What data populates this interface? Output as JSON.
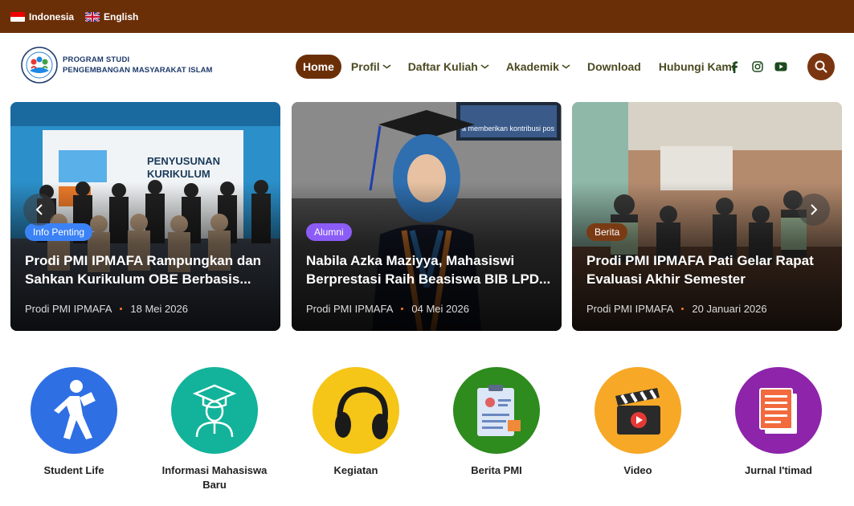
{
  "topbar": {
    "languages": [
      {
        "label": "Indonesia",
        "flag": "indonesia-flag-icon"
      },
      {
        "label": "English",
        "flag": "uk-flag-icon"
      }
    ]
  },
  "logo": {
    "line1": "PROGRAM STUDI",
    "line2": "PENGEMBANGAN MASYARAKAT ISLAM"
  },
  "nav": {
    "items": [
      {
        "label": "Home",
        "active": true
      },
      {
        "label": "Profil",
        "dropdown": true
      },
      {
        "label": "Daftar Kuliah",
        "dropdown": true
      },
      {
        "label": "Akademik",
        "dropdown": true
      },
      {
        "label": "Download"
      },
      {
        "label": "Hubungi Kami"
      }
    ],
    "chevron": "⌄",
    "socials": [
      "facebook-icon",
      "instagram-icon",
      "youtube-icon"
    ]
  },
  "cards": [
    {
      "badge": "Info Penting",
      "badge_color": "#3b82f6",
      "title": "Prodi PMI IPMAFA Rampungkan dan Sahkan Kurikulum OBE Berbasis...",
      "author": "Prodi PMI IPMAFA",
      "date": "18 Mei 2026"
    },
    {
      "badge": "Alumni",
      "badge_color": "#8b5cf6",
      "title": "Nabila Azka Maziyya, Mahasiswi Berprestasi Raih Beasiswa BIB LPD...",
      "author": "Prodi PMI IPMAFA",
      "date": "04 Mei 2026"
    },
    {
      "badge": "Berita",
      "badge_color": "#7a3b14",
      "title": "Prodi PMI IPMAFA Pati Gelar Rapat Evaluasi Akhir Semester",
      "author": "Prodi PMI IPMAFA",
      "date": "20 Januari 2026"
    }
  ],
  "slider": {
    "prev": "‹",
    "next": "›"
  },
  "categories": [
    {
      "label": "Student Life",
      "color": "#2f6fe4",
      "icon": "student-walking-icon"
    },
    {
      "label": "Informasi Mahasiswa Baru",
      "color": "#12b39a",
      "icon": "graduate-icon"
    },
    {
      "label": "Kegiatan",
      "color": "#f5c518",
      "icon": "headphones-icon"
    },
    {
      "label": "Berita PMI",
      "color": "#2e8b1e",
      "icon": "clipboard-icon"
    },
    {
      "label": "Video",
      "color": "#f7a826",
      "icon": "clapperboard-icon"
    },
    {
      "label": "Jurnal I'timad",
      "color": "#8e24aa",
      "icon": "document-icon"
    }
  ]
}
